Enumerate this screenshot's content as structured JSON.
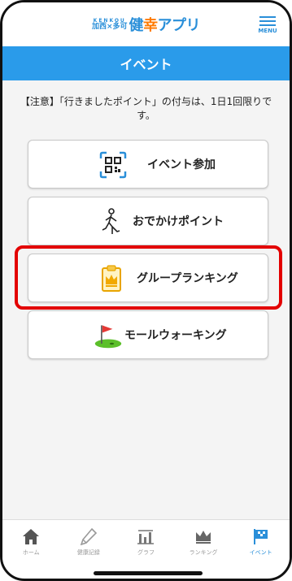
{
  "header": {
    "logo_kenkou": "KENKOU",
    "logo_cities": "加西×多可",
    "logo_main_1": "健",
    "logo_main_2": "幸",
    "logo_main_3": "アプリ",
    "menu_label": "MENU"
  },
  "title": "イベント",
  "notice": "【注意】「行きましたポイント」の付与は、1日1回限りです。",
  "buttons": [
    {
      "label": "イベント参加",
      "icon": "qr-code-icon"
    },
    {
      "label": "おでかけポイント",
      "icon": "walking-person-icon"
    },
    {
      "label": "グループランキング",
      "icon": "crown-clipboard-icon"
    },
    {
      "label": "モールウォーキング",
      "icon": "golf-flag-icon"
    }
  ],
  "nav": [
    {
      "label": "ホーム",
      "icon": "home-icon"
    },
    {
      "label": "健康記録",
      "icon": "pencil-icon"
    },
    {
      "label": "グラフ",
      "icon": "bar-graph-icon"
    },
    {
      "label": "ランキング",
      "icon": "crown-icon"
    },
    {
      "label": "イベント",
      "icon": "event-flag-icon",
      "active": true
    }
  ],
  "colors": {
    "accent": "#2a9bea",
    "highlight": "#e30000",
    "brand_orange": "#ff7a00"
  }
}
